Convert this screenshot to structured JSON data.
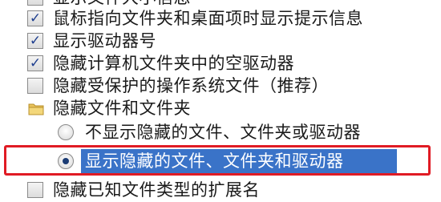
{
  "options": [
    {
      "label": "显示文件大小信息",
      "checked": false
    },
    {
      "label": "鼠标指向文件夹和桌面项时显示提示信息",
      "checked": true
    },
    {
      "label": "显示驱动器号",
      "checked": true
    },
    {
      "label": "隐藏计算机文件夹中的空驱动器",
      "checked": true
    },
    {
      "label": "隐藏受保护的操作系统文件（推荐）",
      "checked": false
    }
  ],
  "hidden_files": {
    "label": "隐藏文件和文件夹",
    "option_hide": "不显示隐藏的文件、文件夹或驱动器",
    "option_show": "显示隐藏的文件、文件夹和驱动器",
    "selected": "option_show"
  },
  "last_option": {
    "label": "隐藏已知文件类型的扩展名",
    "checked": false
  },
  "colors": {
    "highlight": "#e01b24",
    "selection": "#3a73c8"
  }
}
